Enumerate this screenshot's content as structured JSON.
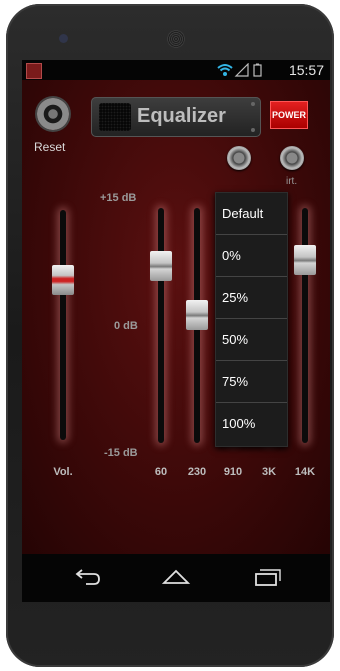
{
  "status_bar": {
    "time": "15:57",
    "app_icon": "equalizer-app-icon",
    "icons": [
      "wifi-icon",
      "signal-icon",
      "battery-icon"
    ]
  },
  "app": {
    "reset_label": "Reset",
    "title": "Equalizer",
    "power_label": "POWER",
    "virt_label": "irt."
  },
  "scale": {
    "top": "+15 dB",
    "mid": "0 dB",
    "bottom": "-15 dB"
  },
  "sliders": [
    {
      "label": "Vol.",
      "level_percent": 72
    },
    {
      "label": "60",
      "level_percent": 79
    },
    {
      "label": "230",
      "level_percent": 55
    }
  ],
  "hidden_band_labels": [
    "910",
    "3K",
    "14K"
  ],
  "hidden_band_levels": [
    null,
    null,
    82
  ],
  "dropdown": {
    "items": [
      "Default",
      "0%",
      "25%",
      "50%",
      "75%",
      "100%"
    ]
  },
  "colors": {
    "background": "#3a0808",
    "power_red": "#d01414",
    "dropdown_bg": "#1c1c1c"
  }
}
